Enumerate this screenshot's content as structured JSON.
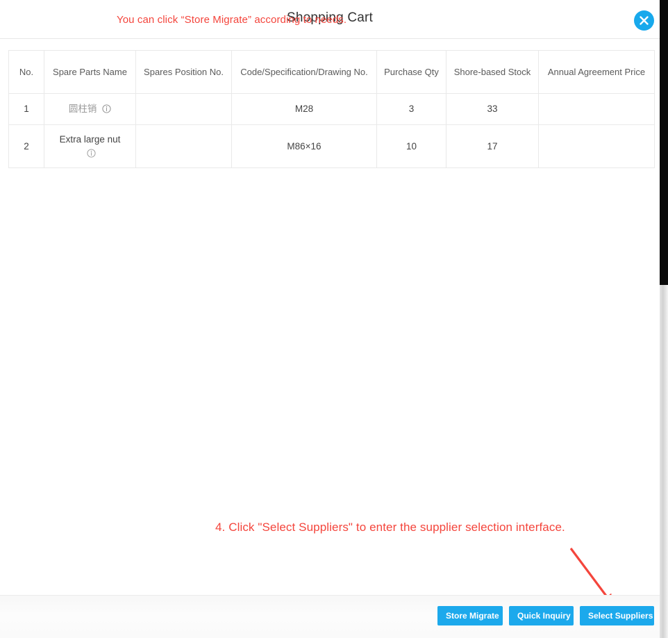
{
  "modal": {
    "title": "Shopping Cart",
    "close_label": "×"
  },
  "table": {
    "headers": [
      "No.",
      "Spare Parts Name",
      "Spares Position No.",
      "Code/Specification/Drawing No.",
      "Purchase Qty",
      "Shore-based Stock",
      "Annual Agreement Price"
    ],
    "rows": [
      {
        "no": "1",
        "name": "圆柱销",
        "position_no": "",
        "code": "M28",
        "purchase_qty": "3",
        "shore_stock": "33",
        "agreement_price": ""
      },
      {
        "no": "2",
        "name": "Extra large nut",
        "position_no": "",
        "code": "M86×16",
        "purchase_qty": "10",
        "shore_stock": "17",
        "agreement_price": ""
      }
    ]
  },
  "footer": {
    "note": "You can click  “Store Migrate”  according to needs.",
    "buttons": {
      "store_migrate": "Store Migrate",
      "quick_inquiry": "Quick Inquiry",
      "select_suppliers": "Select Suppliers"
    }
  },
  "annotations": {
    "step_text": "4. Click \"Select Suppliers\" to enter the supplier selection interface.",
    "accent_color": "#f4453c"
  },
  "colors": {
    "primary_blue": "#1ca9ec",
    "close_blue": "#18a9ec",
    "annotation_red": "#f4453c",
    "table_border": "#e9e9e9",
    "text_dark": "#333333",
    "text_muted": "#9a9a9a"
  }
}
